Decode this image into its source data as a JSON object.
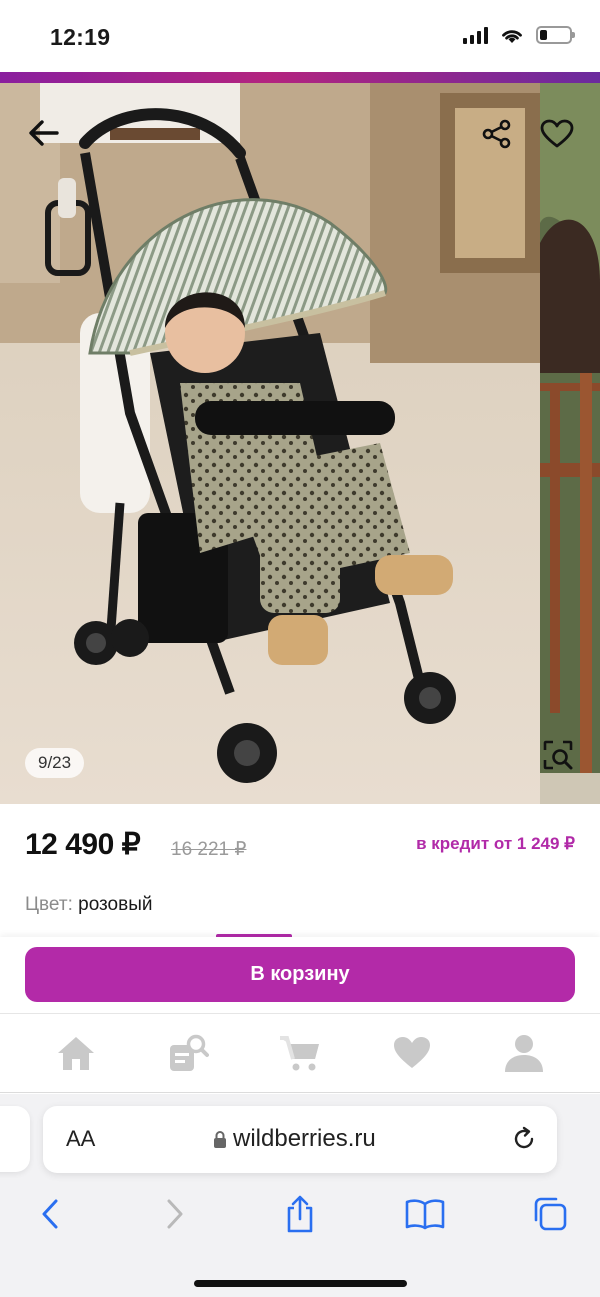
{
  "status": {
    "time": "12:19",
    "battery_level": 0.25
  },
  "gallery": {
    "counter": "9/23",
    "icons": [
      "back-arrow-icon",
      "share-icon",
      "heart-icon",
      "image-search-icon"
    ]
  },
  "product": {
    "price": "12 490 ₽",
    "old_price": "16 221 ₽",
    "credit": "в кредит от 1 249 ₽",
    "color_label": "Цвет:",
    "color_value": "розовый"
  },
  "cart": {
    "button_label": "В корзину"
  },
  "app_nav": {
    "items": [
      "home-icon",
      "catalog-search-icon",
      "cart-icon",
      "favorites-icon",
      "profile-icon"
    ]
  },
  "browser": {
    "text_size_label": "AA",
    "url": "wildberries.ru"
  },
  "colors": {
    "brand": "#b32aa8",
    "brand_gradient_start": "#8a1f9e",
    "brand_gradient_end": "#6b2a9e",
    "ios_blue": "#2a6ff0",
    "nav_gray": "#c9c9c9"
  }
}
